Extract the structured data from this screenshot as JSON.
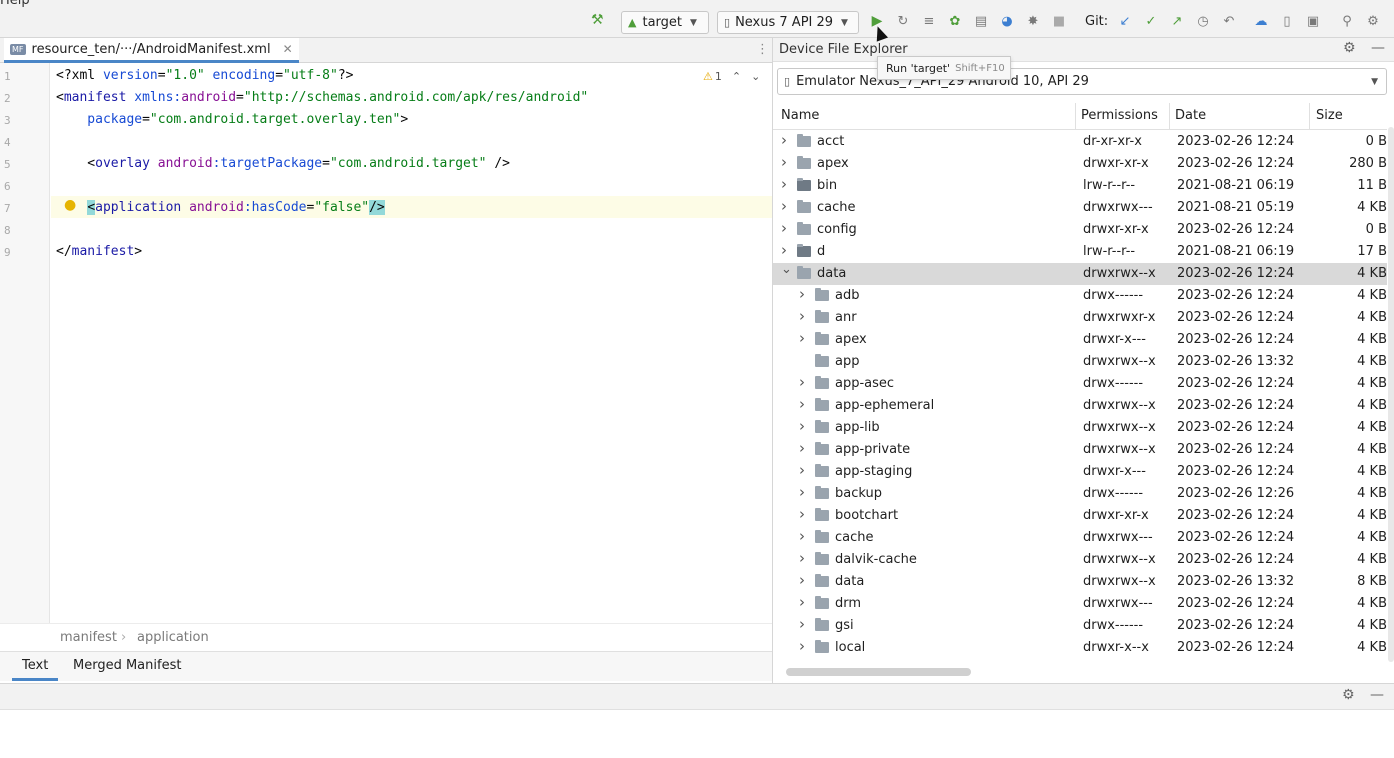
{
  "menu": {
    "help": "Help"
  },
  "toolbar": {
    "run_config": "target",
    "device": "Nexus 7  API 29",
    "git_label": "Git:",
    "colors": {
      "run": "#4f9e3a",
      "git_update": "#3d7fd1",
      "git_commit": "#4f9e3a",
      "git_push": "#4f9e3a",
      "debug": "#4f9e3a"
    }
  },
  "editor": {
    "tab_label": "resource_ten/···/AndroidManifest.xml",
    "tab_icon": "MF",
    "warnings": "1",
    "lines": [
      {
        "n": "1",
        "parts": [
          {
            "t": "<?xml ",
            "c": "c-plain"
          },
          {
            "t": "version",
            "c": "c-attr"
          },
          {
            "t": "=",
            "c": "c-plain"
          },
          {
            "t": "\"1.0\"",
            "c": "c-val"
          },
          {
            "t": " encoding",
            "c": "c-attr"
          },
          {
            "t": "=",
            "c": "c-plain"
          },
          {
            "t": "\"utf-8\"",
            "c": "c-val"
          },
          {
            "t": "?>",
            "c": "c-plain"
          }
        ]
      },
      {
        "n": "2",
        "parts": [
          {
            "t": "<",
            "c": "c-plain"
          },
          {
            "t": "manifest ",
            "c": "c-tag"
          },
          {
            "t": "xmlns:",
            "c": "c-attr"
          },
          {
            "t": "android",
            "c": "c-ns"
          },
          {
            "t": "=",
            "c": "c-plain"
          },
          {
            "t": "\"http://schemas.android.com/apk/res/android\"",
            "c": "c-val"
          }
        ]
      },
      {
        "n": "3",
        "parts": [
          {
            "t": "    package",
            "c": "c-attr"
          },
          {
            "t": "=",
            "c": "c-plain"
          },
          {
            "t": "\"com.android.target.overlay.ten\"",
            "c": "c-val"
          },
          {
            "t": ">",
            "c": "c-plain"
          }
        ]
      },
      {
        "n": "4",
        "parts": []
      },
      {
        "n": "5",
        "parts": [
          {
            "t": "    <",
            "c": "c-plain"
          },
          {
            "t": "overlay ",
            "c": "c-tag"
          },
          {
            "t": "android",
            "c": "c-ns"
          },
          {
            "t": ":targetPackage",
            "c": "c-attr"
          },
          {
            "t": "=",
            "c": "c-plain"
          },
          {
            "t": "\"com.android.target\"",
            "c": "c-val"
          },
          {
            "t": " />",
            "c": "c-plain"
          }
        ]
      },
      {
        "n": "6",
        "parts": []
      },
      {
        "n": "7",
        "parts": [
          {
            "t": "    <",
            "c": "c-plain"
          },
          {
            "t": "application ",
            "c": "c-tag"
          },
          {
            "t": "android",
            "c": "c-ns"
          },
          {
            "t": ":hasCode",
            "c": "c-attr"
          },
          {
            "t": "=",
            "c": "c-plain"
          },
          {
            "t": "\"false\"",
            "c": "c-val"
          },
          {
            "t": "/>",
            "c": "c-plain"
          }
        ]
      },
      {
        "n": "8",
        "parts": []
      },
      {
        "n": "9",
        "parts": [
          {
            "t": "</",
            "c": "c-plain"
          },
          {
            "t": "manifest",
            "c": "c-tag"
          },
          {
            "t": ">",
            "c": "c-plain"
          }
        ]
      }
    ],
    "breadcrumbs": [
      "manifest",
      "application"
    ],
    "bottom_tabs": [
      "Text",
      "Merged Manifest"
    ]
  },
  "explorer": {
    "title": "Device File Explorer",
    "device": "Emulator Nexus_7_API_29 Android 10, API 29",
    "columns": [
      "Name",
      "Permissions",
      "Date",
      "Size"
    ],
    "rows": [
      {
        "level": 0,
        "expand": "collapsed",
        "icon": "folder",
        "name": "acct",
        "perm": "dr-xr-xr-x",
        "date": "2023-02-26 12:24",
        "size": "0 B"
      },
      {
        "level": 0,
        "expand": "collapsed",
        "icon": "folder",
        "name": "apex",
        "perm": "drwxr-xr-x",
        "date": "2023-02-26 12:24",
        "size": "280 B"
      },
      {
        "level": 0,
        "expand": "collapsed",
        "icon": "link",
        "name": "bin",
        "perm": "lrw-r--r--",
        "date": "2021-08-21 06:19",
        "size": "11 B"
      },
      {
        "level": 0,
        "expand": "collapsed",
        "icon": "folder",
        "name": "cache",
        "perm": "drwxrwx---",
        "date": "2021-08-21 05:19",
        "size": "4 KB"
      },
      {
        "level": 0,
        "expand": "collapsed",
        "icon": "folder",
        "name": "config",
        "perm": "drwxr-xr-x",
        "date": "2023-02-26 12:24",
        "size": "0 B"
      },
      {
        "level": 0,
        "expand": "collapsed",
        "icon": "link",
        "name": "d",
        "perm": "lrw-r--r--",
        "date": "2021-08-21 06:19",
        "size": "17 B"
      },
      {
        "level": 0,
        "expand": "expanded",
        "icon": "folder",
        "name": "data",
        "perm": "drwxrwx--x",
        "date": "2023-02-26 12:24",
        "size": "4 KB",
        "selected": true
      },
      {
        "level": 1,
        "expand": "collapsed",
        "icon": "folder",
        "name": "adb",
        "perm": "drwx------",
        "date": "2023-02-26 12:24",
        "size": "4 KB"
      },
      {
        "level": 1,
        "expand": "collapsed",
        "icon": "folder",
        "name": "anr",
        "perm": "drwxrwxr-x",
        "date": "2023-02-26 12:24",
        "size": "4 KB"
      },
      {
        "level": 1,
        "expand": "collapsed",
        "icon": "folder",
        "name": "apex",
        "perm": "drwxr-x---",
        "date": "2023-02-26 12:24",
        "size": "4 KB"
      },
      {
        "level": 1,
        "expand": "none",
        "icon": "folder",
        "name": "app",
        "perm": "drwxrwx--x",
        "date": "2023-02-26 13:32",
        "size": "4 KB"
      },
      {
        "level": 1,
        "expand": "collapsed",
        "icon": "folder",
        "name": "app-asec",
        "perm": "drwx------",
        "date": "2023-02-26 12:24",
        "size": "4 KB"
      },
      {
        "level": 1,
        "expand": "collapsed",
        "icon": "folder",
        "name": "app-ephemeral",
        "perm": "drwxrwx--x",
        "date": "2023-02-26 12:24",
        "size": "4 KB"
      },
      {
        "level": 1,
        "expand": "collapsed",
        "icon": "folder",
        "name": "app-lib",
        "perm": "drwxrwx--x",
        "date": "2023-02-26 12:24",
        "size": "4 KB"
      },
      {
        "level": 1,
        "expand": "collapsed",
        "icon": "folder",
        "name": "app-private",
        "perm": "drwxrwx--x",
        "date": "2023-02-26 12:24",
        "size": "4 KB"
      },
      {
        "level": 1,
        "expand": "collapsed",
        "icon": "folder",
        "name": "app-staging",
        "perm": "drwxr-x---",
        "date": "2023-02-26 12:24",
        "size": "4 KB"
      },
      {
        "level": 1,
        "expand": "collapsed",
        "icon": "folder",
        "name": "backup",
        "perm": "drwx------",
        "date": "2023-02-26 12:26",
        "size": "4 KB"
      },
      {
        "level": 1,
        "expand": "collapsed",
        "icon": "folder",
        "name": "bootchart",
        "perm": "drwxr-xr-x",
        "date": "2023-02-26 12:24",
        "size": "4 KB"
      },
      {
        "level": 1,
        "expand": "collapsed",
        "icon": "folder",
        "name": "cache",
        "perm": "drwxrwx---",
        "date": "2023-02-26 12:24",
        "size": "4 KB"
      },
      {
        "level": 1,
        "expand": "collapsed",
        "icon": "folder",
        "name": "dalvik-cache",
        "perm": "drwxrwx--x",
        "date": "2023-02-26 12:24",
        "size": "4 KB"
      },
      {
        "level": 1,
        "expand": "collapsed",
        "icon": "folder",
        "name": "data",
        "perm": "drwxrwx--x",
        "date": "2023-02-26 13:32",
        "size": "8 KB"
      },
      {
        "level": 1,
        "expand": "collapsed",
        "icon": "folder",
        "name": "drm",
        "perm": "drwxrwx---",
        "date": "2023-02-26 12:24",
        "size": "4 KB"
      },
      {
        "level": 1,
        "expand": "collapsed",
        "icon": "folder",
        "name": "gsi",
        "perm": "drwx------",
        "date": "2023-02-26 12:24",
        "size": "4 KB"
      },
      {
        "level": 1,
        "expand": "collapsed",
        "icon": "folder",
        "name": "local",
        "perm": "drwxr-x--x",
        "date": "2023-02-26 12:24",
        "size": "4 KB"
      }
    ]
  },
  "tooltip": {
    "text": "Run 'target'",
    "shortcut": "Shift+F10"
  }
}
